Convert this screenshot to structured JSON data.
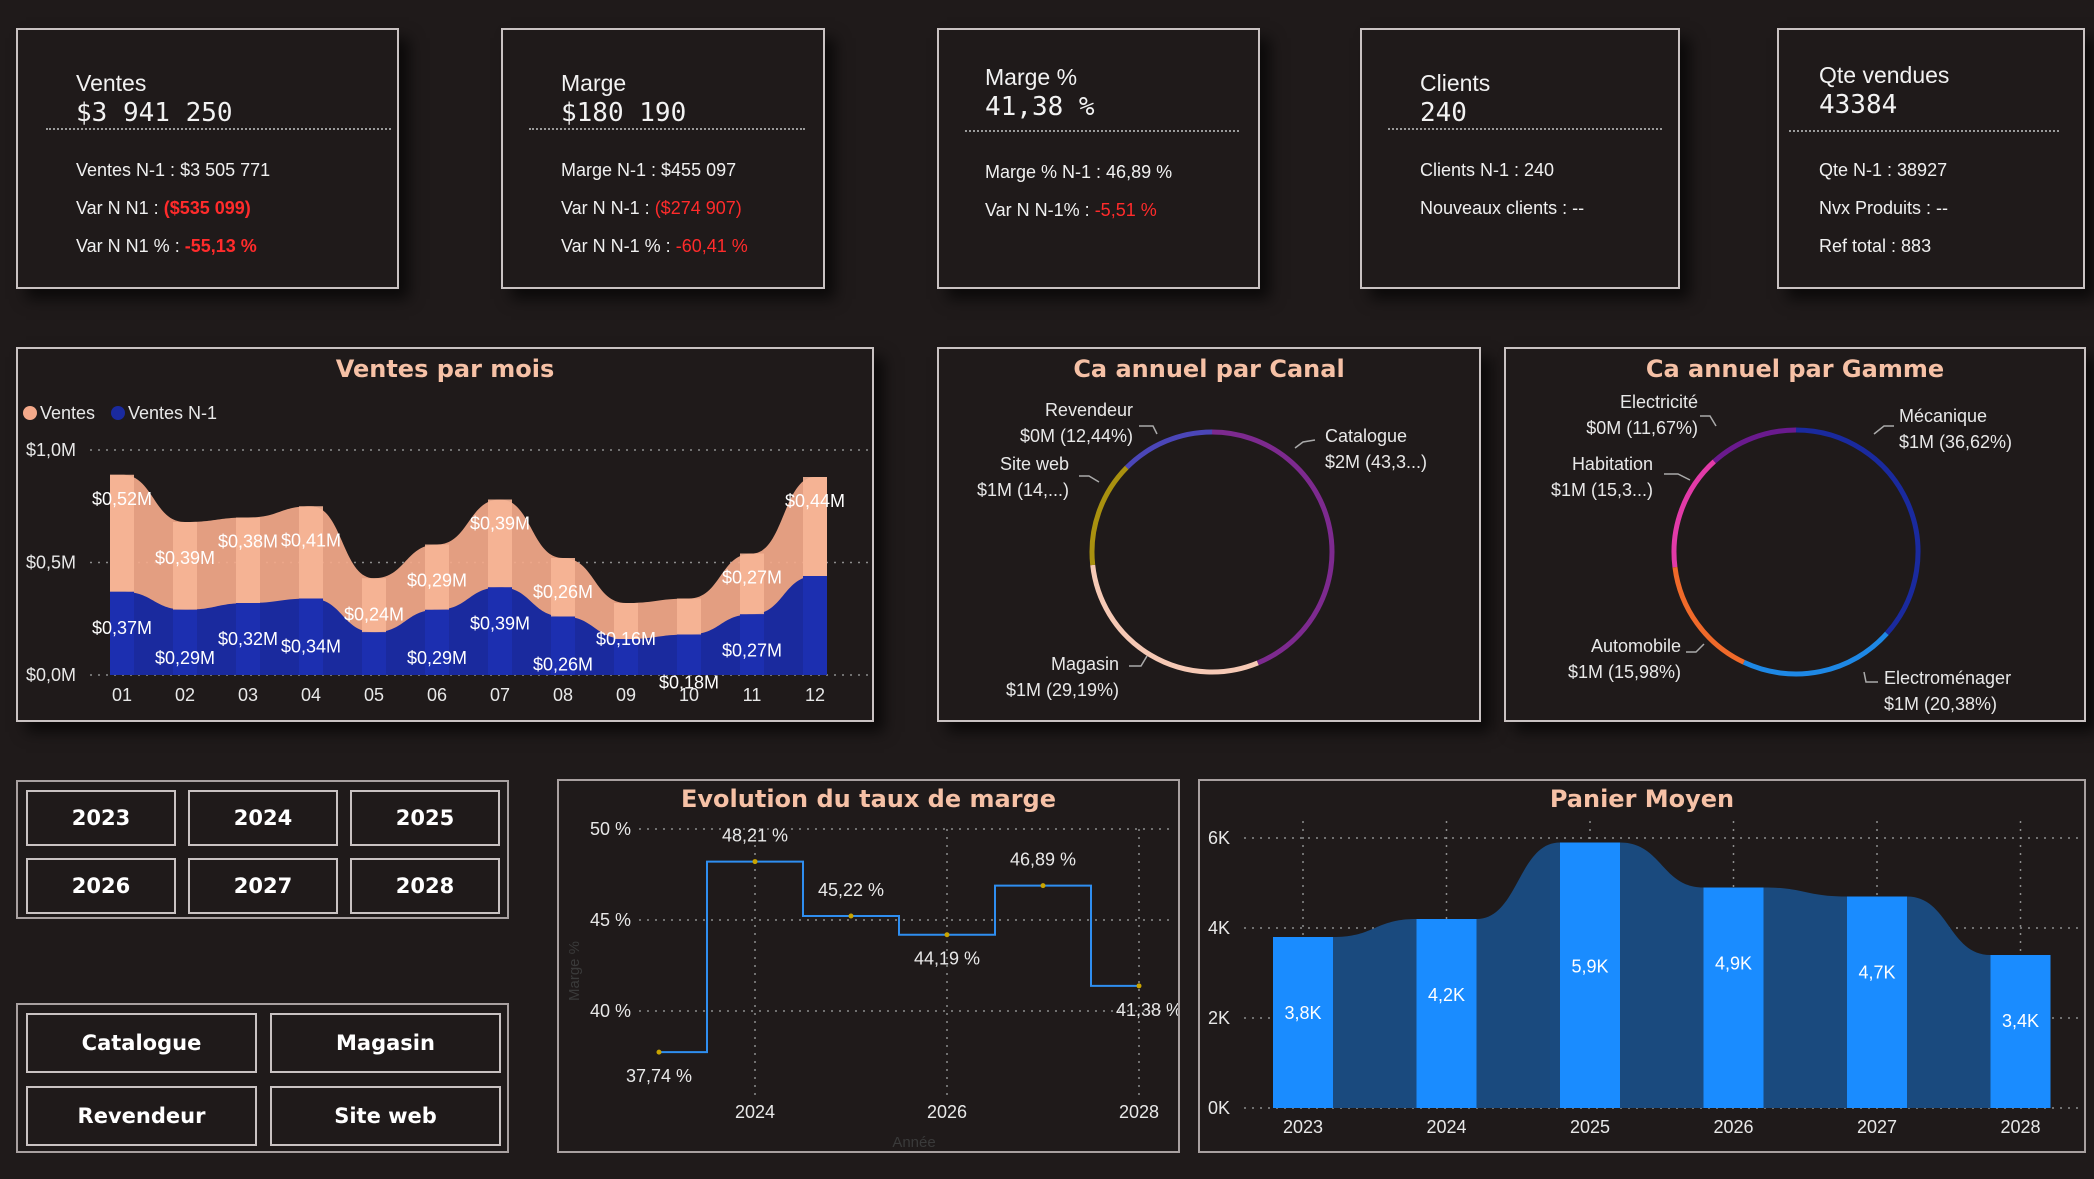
{
  "kpis": {
    "ventes": {
      "title": "Ventes",
      "value": "$3 941 250",
      "rows": [
        {
          "label": "Ventes N-1 :",
          "value": "$3 505 771",
          "tone": "normal"
        },
        {
          "label": "Var N N1 :",
          "value": "($535 099)",
          "tone": "redbold"
        },
        {
          "label": "Var N N1 % :",
          "value": "-55,13 %",
          "tone": "redbold"
        }
      ]
    },
    "marge": {
      "title": "Marge",
      "value": "$180 190",
      "rows": [
        {
          "label": "Marge N-1 :",
          "value": "$455 097",
          "tone": "normal"
        },
        {
          "label": "Var N N-1 :",
          "value": "($274 907)",
          "tone": "red"
        },
        {
          "label": "Var N N-1 % :",
          "value": "-60,41 %",
          "tone": "red"
        }
      ]
    },
    "marge_pct": {
      "title": "Marge %",
      "value": "41,38 %",
      "rows": [
        {
          "label": "Marge % N-1 :",
          "value": "46,89 %",
          "tone": "normal"
        },
        {
          "label": "Var N N-1% :",
          "value": "-5,51 %",
          "tone": "red"
        }
      ]
    },
    "clients": {
      "title": "Clients",
      "value": "240",
      "rows": [
        {
          "label": "Clients N-1 :",
          "value": "240",
          "tone": "normal"
        },
        {
          "label": "Nouveaux clients :",
          "value": "--",
          "tone": "normal"
        }
      ]
    },
    "qte": {
      "title": "Qte vendues",
      "value": "43384",
      "rows": [
        {
          "label": "Qte N-1 :",
          "value": "38927",
          "tone": "normal"
        },
        {
          "label": "Nvx Produits :",
          "value": "--",
          "tone": "normal"
        },
        {
          "label": "Ref total :",
          "value": "883",
          "tone": "normal"
        }
      ]
    }
  },
  "ventes_par_mois": {
    "title": "Ventes par mois",
    "legend": [
      {
        "name": "Ventes",
        "color": "#f4a98a"
      },
      {
        "name": "Ventes N-1",
        "color": "#1a2a9e"
      }
    ],
    "chart_data": {
      "type": "area",
      "stacked": true,
      "categories": [
        "01",
        "02",
        "03",
        "04",
        "05",
        "06",
        "07",
        "08",
        "09",
        "10",
        "11",
        "12"
      ],
      "series": [
        {
          "name": "Ventes N-1",
          "color": "#1a2a9e",
          "values": [
            0.37,
            0.29,
            0.32,
            0.34,
            0.19,
            0.29,
            0.39,
            0.26,
            0.16,
            0.18,
            0.27,
            0.44
          ],
          "labels": [
            "$0,37M",
            "$0,29M",
            "$0,32M",
            "$0,34M",
            "",
            "$0,29M",
            "$0,39M",
            "$0,26M",
            "",
            "$0,18M",
            "$0,27M",
            ""
          ]
        },
        {
          "name": "Ventes",
          "color": "#f4a98a",
          "values": [
            0.52,
            0.39,
            0.38,
            0.41,
            0.24,
            0.29,
            0.39,
            0.26,
            0.16,
            0.16,
            0.27,
            0.44
          ],
          "labels": [
            "$0,52M",
            "$0,39M",
            "$0,38M",
            "$0,41M",
            "$0,24M",
            "$0,29M",
            "$0,39M",
            "$0,26M",
            "$0,16M",
            "",
            "$0,27M",
            "$0,44M"
          ]
        }
      ],
      "yticks": [
        "$1,0M",
        "$0,5M",
        "$0,0M"
      ],
      "ylim": [
        0,
        1.0
      ],
      "grid": true
    }
  },
  "ca_canal": {
    "title": "Ca annuel par Canal",
    "chart_data": {
      "type": "pie",
      "donut": true,
      "slices": [
        {
          "name": "Catalogue",
          "label": "$2M (43,3...)",
          "value": 43.3,
          "color": "#7d2a8f"
        },
        {
          "name": "Magasin",
          "label": "$1M (29,19%)",
          "value": 29.19,
          "color": "#f6c9b5"
        },
        {
          "name": "Site web",
          "label": "$1M (14,...)",
          "value": 14.0,
          "color": "#a9910f"
        },
        {
          "name": "Revendeur",
          "label": "$0M (12,44%)",
          "value": 12.44,
          "color": "#4b46b8"
        }
      ]
    }
  },
  "ca_gamme": {
    "title": "Ca annuel par Gamme",
    "chart_data": {
      "type": "pie",
      "donut": true,
      "slices": [
        {
          "name": "Mécanique",
          "label": "$1M (36,62%)",
          "value": 36.62,
          "color": "#1a2a9e"
        },
        {
          "name": "Electroménager",
          "label": "$1M (20,38%)",
          "value": 20.38,
          "color": "#1e88e5"
        },
        {
          "name": "Automobile",
          "label": "$1M (15,98%)",
          "value": 15.98,
          "color": "#f06a2a"
        },
        {
          "name": "Habitation",
          "label": "$1M (15,3...)",
          "value": 15.3,
          "color": "#e23aa8"
        },
        {
          "name": "Electricité",
          "label": "$0M (11,67%)",
          "value": 11.67,
          "color": "#6a1a8e"
        }
      ]
    }
  },
  "taux_marge": {
    "title": "Evolution du taux de marge",
    "chart_data": {
      "type": "line",
      "step": true,
      "x": [
        2023,
        2024,
        2025,
        2026,
        2027,
        2028
      ],
      "values": [
        37.74,
        48.21,
        45.22,
        44.19,
        46.89,
        41.38
      ],
      "labels": [
        "37,74 %",
        "48,21 %",
        "45,22 %",
        "44,19 %",
        "46,89 %",
        "41,38 %"
      ],
      "yticks": [
        "50 %",
        "45 %",
        "40 %"
      ],
      "xticks": [
        "2024",
        "2026",
        "2028"
      ],
      "ylim": [
        36,
        51
      ],
      "ylabel": "Marge %",
      "xlabel": "Année",
      "color": "#2f8ef0"
    }
  },
  "panier_moyen": {
    "title": "Panier Moyen",
    "chart_data": {
      "type": "bar",
      "categories": [
        "2023",
        "2024",
        "2025",
        "2026",
        "2027",
        "2028"
      ],
      "values": [
        3.8,
        4.2,
        5.9,
        4.9,
        4.7,
        3.4
      ],
      "labels": [
        "3,8K",
        "4,2K",
        "5,9K",
        "4,9K",
        "4,7K",
        "3,4K"
      ],
      "yticks": [
        "6K",
        "4K",
        "2K",
        "0K"
      ],
      "ylim": [
        0,
        6
      ],
      "bar_color": "#1a8cff",
      "area_color": "#1a4a7e"
    }
  },
  "year_slicer": {
    "items": [
      "2023",
      "2024",
      "2025",
      "2026",
      "2027",
      "2028"
    ]
  },
  "canal_slicer": {
    "items": [
      "Catalogue",
      "Magasin",
      "Revendeur",
      "Site web"
    ]
  }
}
